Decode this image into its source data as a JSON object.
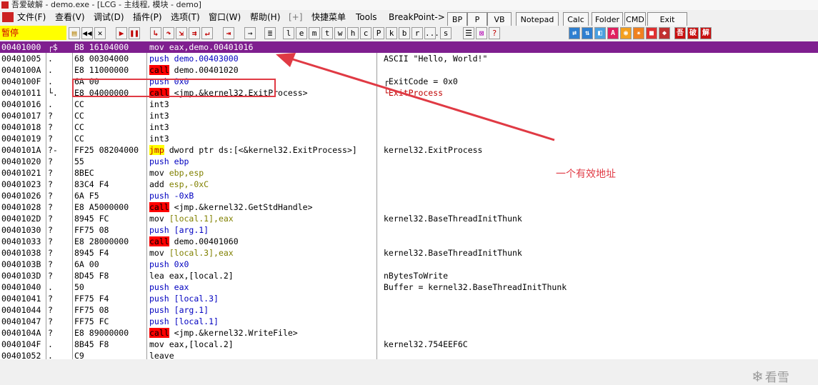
{
  "window": {
    "title": "吾爱破解 - demo.exe - [LCG - 主线程, 模块 - demo]"
  },
  "menu": [
    {
      "label": "文件(F)"
    },
    {
      "label": "查看(V)"
    },
    {
      "label": "调试(D)"
    },
    {
      "label": "插件(P)"
    },
    {
      "label": "选项(T)"
    },
    {
      "label": "窗口(W)"
    },
    {
      "label": "帮助(H)"
    },
    {
      "label": "[+]"
    },
    {
      "label": "快捷菜单"
    },
    {
      "label": "Tools"
    },
    {
      "label": "BreakPoint->"
    }
  ],
  "ext_buttons": [
    {
      "label": "BP"
    },
    {
      "label": "P"
    },
    {
      "label": "VB"
    },
    {
      "label": "Notepad"
    },
    {
      "label": "Calc"
    },
    {
      "label": "Folder"
    },
    {
      "label": "CMD"
    },
    {
      "label": "Exit"
    }
  ],
  "toolbar": {
    "status": "暂停",
    "letters": [
      "l",
      "e",
      "m",
      "t",
      "w",
      "h",
      "c",
      "P",
      "k",
      "b",
      "r",
      "...",
      "s"
    ],
    "right_chips": [
      "吾",
      "破",
      "解"
    ]
  },
  "disasm": {
    "rows": [
      {
        "addr": "00401000",
        "mark": "┌$",
        "bytes": "B8 16104000",
        "mn": "mov",
        "ops": "eax,demo.00401016",
        "cmt": "",
        "selected": true
      },
      {
        "addr": "00401005",
        "mark": ".",
        "bytes": "68 00304000",
        "mn": "push",
        "ops": "demo.00403000",
        "cmt": "ASCII \"Hello, World!\""
      },
      {
        "addr": "0040100A",
        "mark": ".",
        "bytes": "E8 11000000",
        "mn": "call",
        "ops": "demo.00401020",
        "cmt": ""
      },
      {
        "addr": "0040100F",
        "mark": ".",
        "bytes": "6A 00",
        "mn": "push",
        "ops": "0x0",
        "cmt": "┌ExitCode = 0x0"
      },
      {
        "addr": "00401011",
        "mark": "└.",
        "bytes": "E8 04000000",
        "mn": "call",
        "ops": "<jmp.&kernel32.ExitProcess>",
        "cmt": "└ExitProcess"
      },
      {
        "addr": "00401016",
        "mark": ".",
        "bytes": "CC",
        "mn": "int3",
        "ops": "",
        "cmt": ""
      },
      {
        "addr": "00401017",
        "mark": "?",
        "bytes": "CC",
        "mn": "int3",
        "ops": "",
        "cmt": ""
      },
      {
        "addr": "00401018",
        "mark": "?",
        "bytes": "CC",
        "mn": "int3",
        "ops": "",
        "cmt": ""
      },
      {
        "addr": "00401019",
        "mark": "?",
        "bytes": "CC",
        "mn": "int3",
        "ops": "",
        "cmt": ""
      },
      {
        "addr": "0040101A",
        "mark": "?-",
        "bytes": "FF25 08204000",
        "mn": "jmp",
        "ops": "dword ptr ds:[<&kernel32.ExitProcess>]",
        "cmt": "kernel32.ExitProcess"
      },
      {
        "addr": "00401020",
        "mark": "?",
        "bytes": "55",
        "mn": "push",
        "ops": "ebp",
        "cmt": ""
      },
      {
        "addr": "00401021",
        "mark": "?",
        "bytes": "8BEC",
        "mn": "mov",
        "ops": "ebp,esp",
        "cmt": ""
      },
      {
        "addr": "00401023",
        "mark": "?",
        "bytes": "83C4 F4",
        "mn": "add",
        "ops": "esp,-0xC",
        "cmt": ""
      },
      {
        "addr": "00401026",
        "mark": "?",
        "bytes": "6A F5",
        "mn": "push",
        "ops": "-0xB",
        "cmt": ""
      },
      {
        "addr": "00401028",
        "mark": "?",
        "bytes": "E8 A5000000",
        "mn": "call",
        "ops": "<jmp.&kernel32.GetStdHandle>",
        "cmt": ""
      },
      {
        "addr": "0040102D",
        "mark": "?",
        "bytes": "8945 FC",
        "mn": "mov",
        "ops": "[local.1],eax",
        "cmt": "kernel32.BaseThreadInitThunk"
      },
      {
        "addr": "00401030",
        "mark": "?",
        "bytes": "FF75 08",
        "mn": "push",
        "ops": "[arg.1]",
        "cmt": ""
      },
      {
        "addr": "00401033",
        "mark": "?",
        "bytes": "E8 28000000",
        "mn": "call",
        "ops": "demo.00401060",
        "cmt": ""
      },
      {
        "addr": "00401038",
        "mark": "?",
        "bytes": "8945 F4",
        "mn": "mov",
        "ops": "[local.3],eax",
        "cmt": "kernel32.BaseThreadInitThunk"
      },
      {
        "addr": "0040103B",
        "mark": "?",
        "bytes": "6A 00",
        "mn": "push",
        "ops": "0x0",
        "cmt": ""
      },
      {
        "addr": "0040103D",
        "mark": "?",
        "bytes": "8D45 F8",
        "mn": "lea",
        "ops": "eax,[local.2]",
        "cmt": "nBytesToWrite"
      },
      {
        "addr": "00401040",
        "mark": ".",
        "bytes": "50",
        "mn": "push",
        "ops": "eax",
        "cmt": "Buffer = kernel32.BaseThreadInitThunk"
      },
      {
        "addr": "00401041",
        "mark": "?",
        "bytes": "FF75 F4",
        "mn": "push",
        "ops": "[local.3]",
        "cmt": ""
      },
      {
        "addr": "00401044",
        "mark": "?",
        "bytes": "FF75 08",
        "mn": "push",
        "ops": "[arg.1]",
        "cmt": ""
      },
      {
        "addr": "00401047",
        "mark": "?",
        "bytes": "FF75 FC",
        "mn": "push",
        "ops": "[local.1]",
        "cmt": ""
      },
      {
        "addr": "0040104A",
        "mark": "?",
        "bytes": "E8 89000000",
        "mn": "call",
        "ops": "<jmp.&kernel32.WriteFile>",
        "cmt": ""
      },
      {
        "addr": "0040104F",
        "mark": ".",
        "bytes": "8B45 F8",
        "mn": "mov",
        "ops": "eax,[local.2]",
        "cmt": "kernel32.754EEF6C"
      },
      {
        "addr": "00401052",
        "mark": ".",
        "bytes": "C9",
        "mn": "leave",
        "ops": "",
        "cmt": ""
      }
    ]
  },
  "annotation": {
    "text": "一个有效地址"
  },
  "watermark": {
    "text": "看雪"
  },
  "colors": {
    "selection": "#7f1f8f",
    "annotation": "#e03a44",
    "call_bg": "#ff0000",
    "jmp_bg": "#ffff00"
  }
}
